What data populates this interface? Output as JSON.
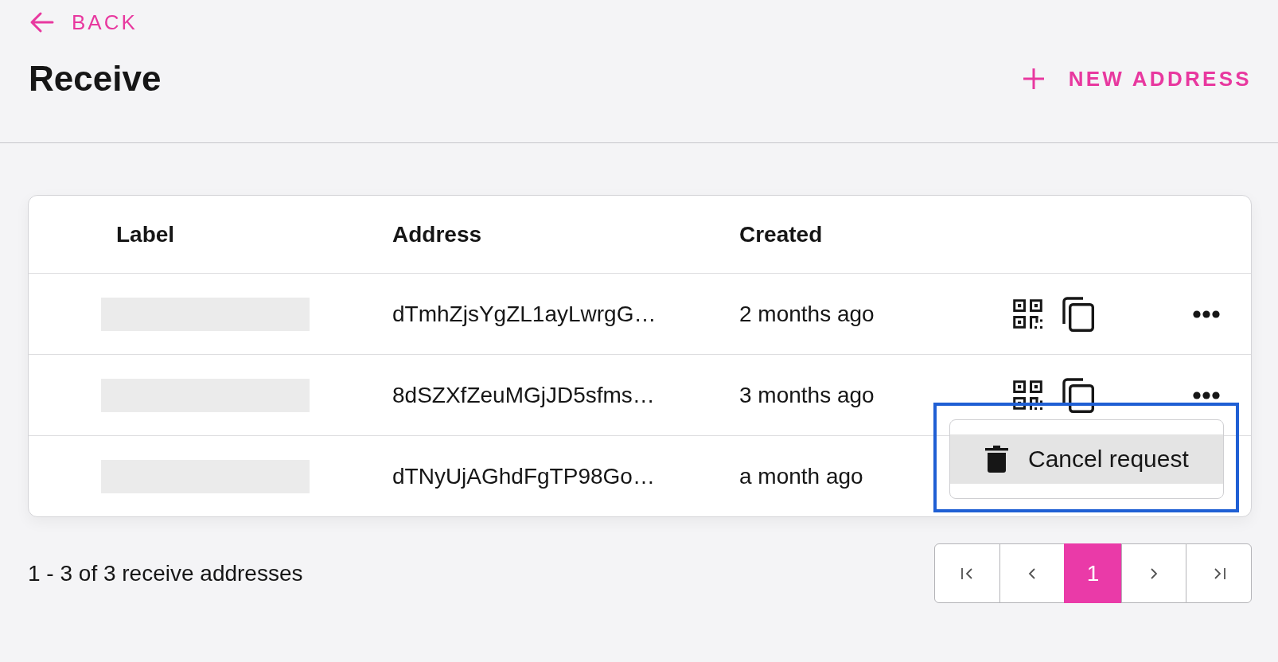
{
  "back_link": {
    "label": "BACK"
  },
  "title": "Receive",
  "new_address_button": {
    "label": "NEW ADDRESS"
  },
  "table": {
    "columns": [
      "Label",
      "Address",
      "Created"
    ],
    "rows": [
      {
        "address": "dTmhZjsYgZL1ayLwrgG…",
        "created": "2 months ago",
        "menu_open": false
      },
      {
        "address": "8dSZXfZeuMGjJD5sfms…",
        "created": "3 months ago",
        "menu_open": true
      },
      {
        "address": "dTNyUjAGhdFgTP98Go…",
        "created": "a month ago",
        "menu_open": false
      }
    ]
  },
  "row_menu": {
    "highlighted": true,
    "items": [
      {
        "label": "Cancel request",
        "hovered": true
      }
    ]
  },
  "footer": {
    "summary": "1 - 3 of 3 receive addresses",
    "pages": [
      {
        "label": "1",
        "selected": true
      }
    ]
  }
}
